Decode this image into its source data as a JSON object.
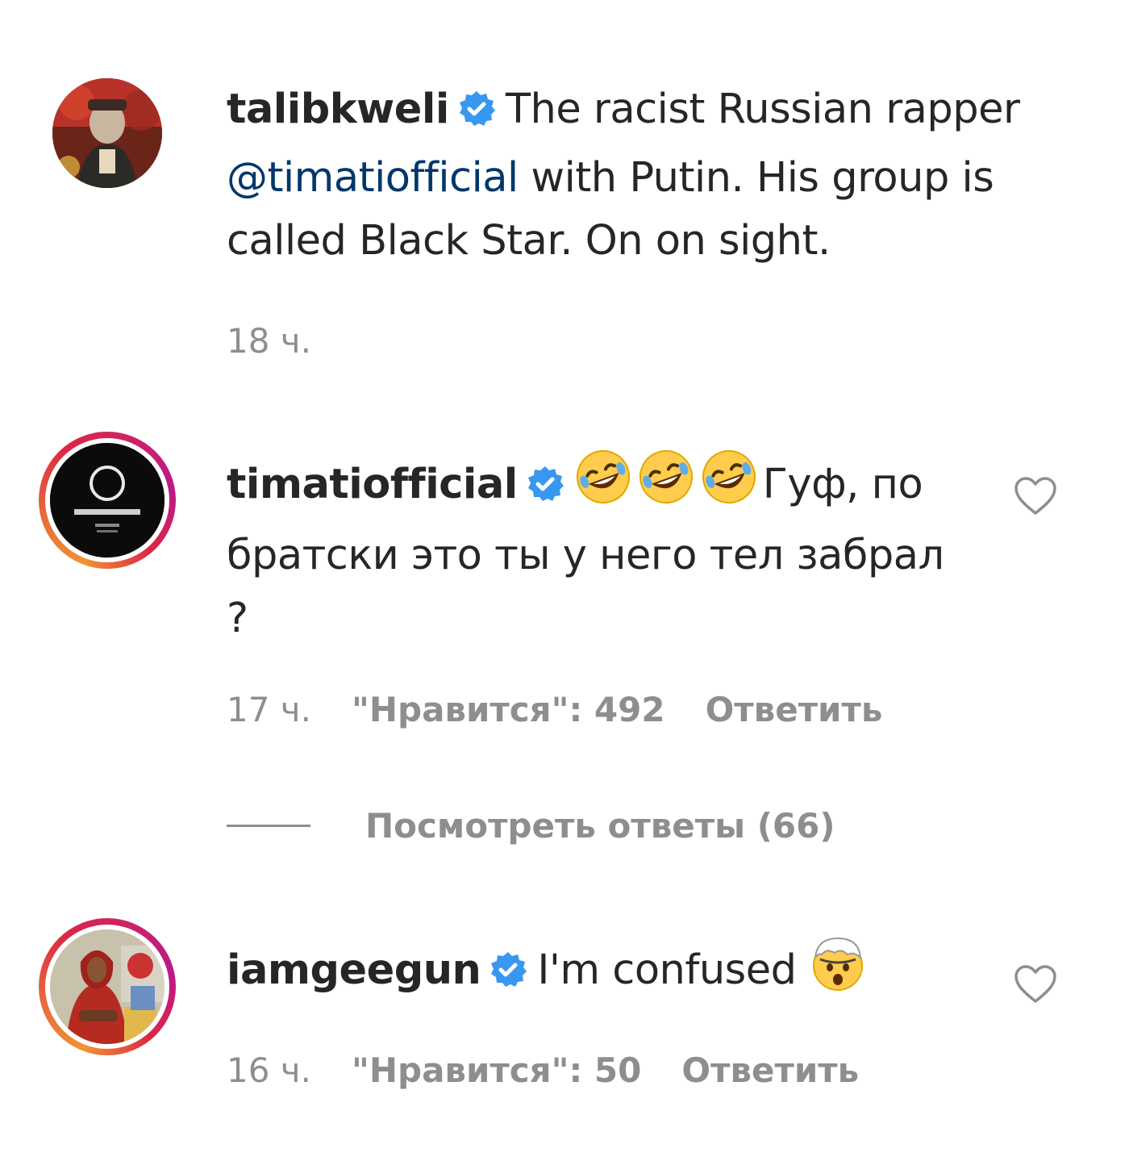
{
  "comments": [
    {
      "username": "talibkweli",
      "text_parts": {
        "before_mention": "The racist Russian rapper",
        "mention": "@timatiofficial",
        "after_mention": "with Putin. His group is called Black Star. On on sight."
      },
      "time": "18 ч.",
      "verified": true
    },
    {
      "username": "timatiofficial",
      "emojis": [
        "rolling-on-floor-laughing",
        "rolling-on-floor-laughing",
        "rolling-on-floor-laughing"
      ],
      "text_line1": "Гуф, по",
      "text_line2": "братски это ты у него тел забрал",
      "text_line3": "?",
      "time": "17 ч.",
      "likes": "\"Нравится\": 492",
      "reply": "Ответить",
      "view_replies": "Посмотреть ответы (66)",
      "verified": true
    },
    {
      "username": "iamgeegun",
      "text": "I'm confused",
      "emoji": "exploding-head",
      "time": "16 ч.",
      "likes": "\"Нравится\": 50",
      "reply": "Ответить",
      "verified": true
    }
  ],
  "colors": {
    "text": "#262626",
    "secondary": "#8e8e8e",
    "link": "#00376b",
    "verified": "#3897f0"
  }
}
